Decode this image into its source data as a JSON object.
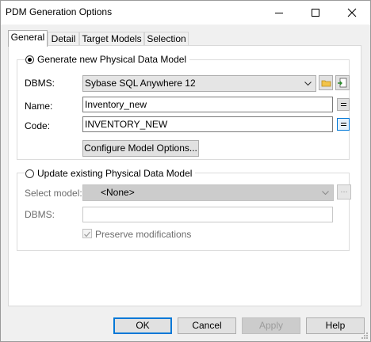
{
  "window": {
    "title": "PDM Generation Options"
  },
  "tabs": [
    {
      "label": "General"
    },
    {
      "label": "Detail"
    },
    {
      "label": "Target Models"
    },
    {
      "label": "Selection"
    }
  ],
  "generate_new": {
    "radio_label": "Generate new Physical Data Model",
    "dbms_label": "DBMS:",
    "dbms_value": "Sybase SQL Anywhere 12",
    "name_label": "Name:",
    "name_value": "Inventory_new",
    "code_label": "Code:",
    "code_value": "INVENTORY_NEW",
    "configure_button": "Configure Model Options..."
  },
  "update_existing": {
    "radio_label": "Update existing Physical Data Model",
    "select_label": "Select model:",
    "select_value": "<None>",
    "dbms_label": "DBMS:",
    "dbms_value": "",
    "preserve_label": "Preserve modifications",
    "browse_label": "..."
  },
  "footer": {
    "ok": "OK",
    "cancel": "Cancel",
    "apply": "Apply",
    "help": "Help"
  }
}
